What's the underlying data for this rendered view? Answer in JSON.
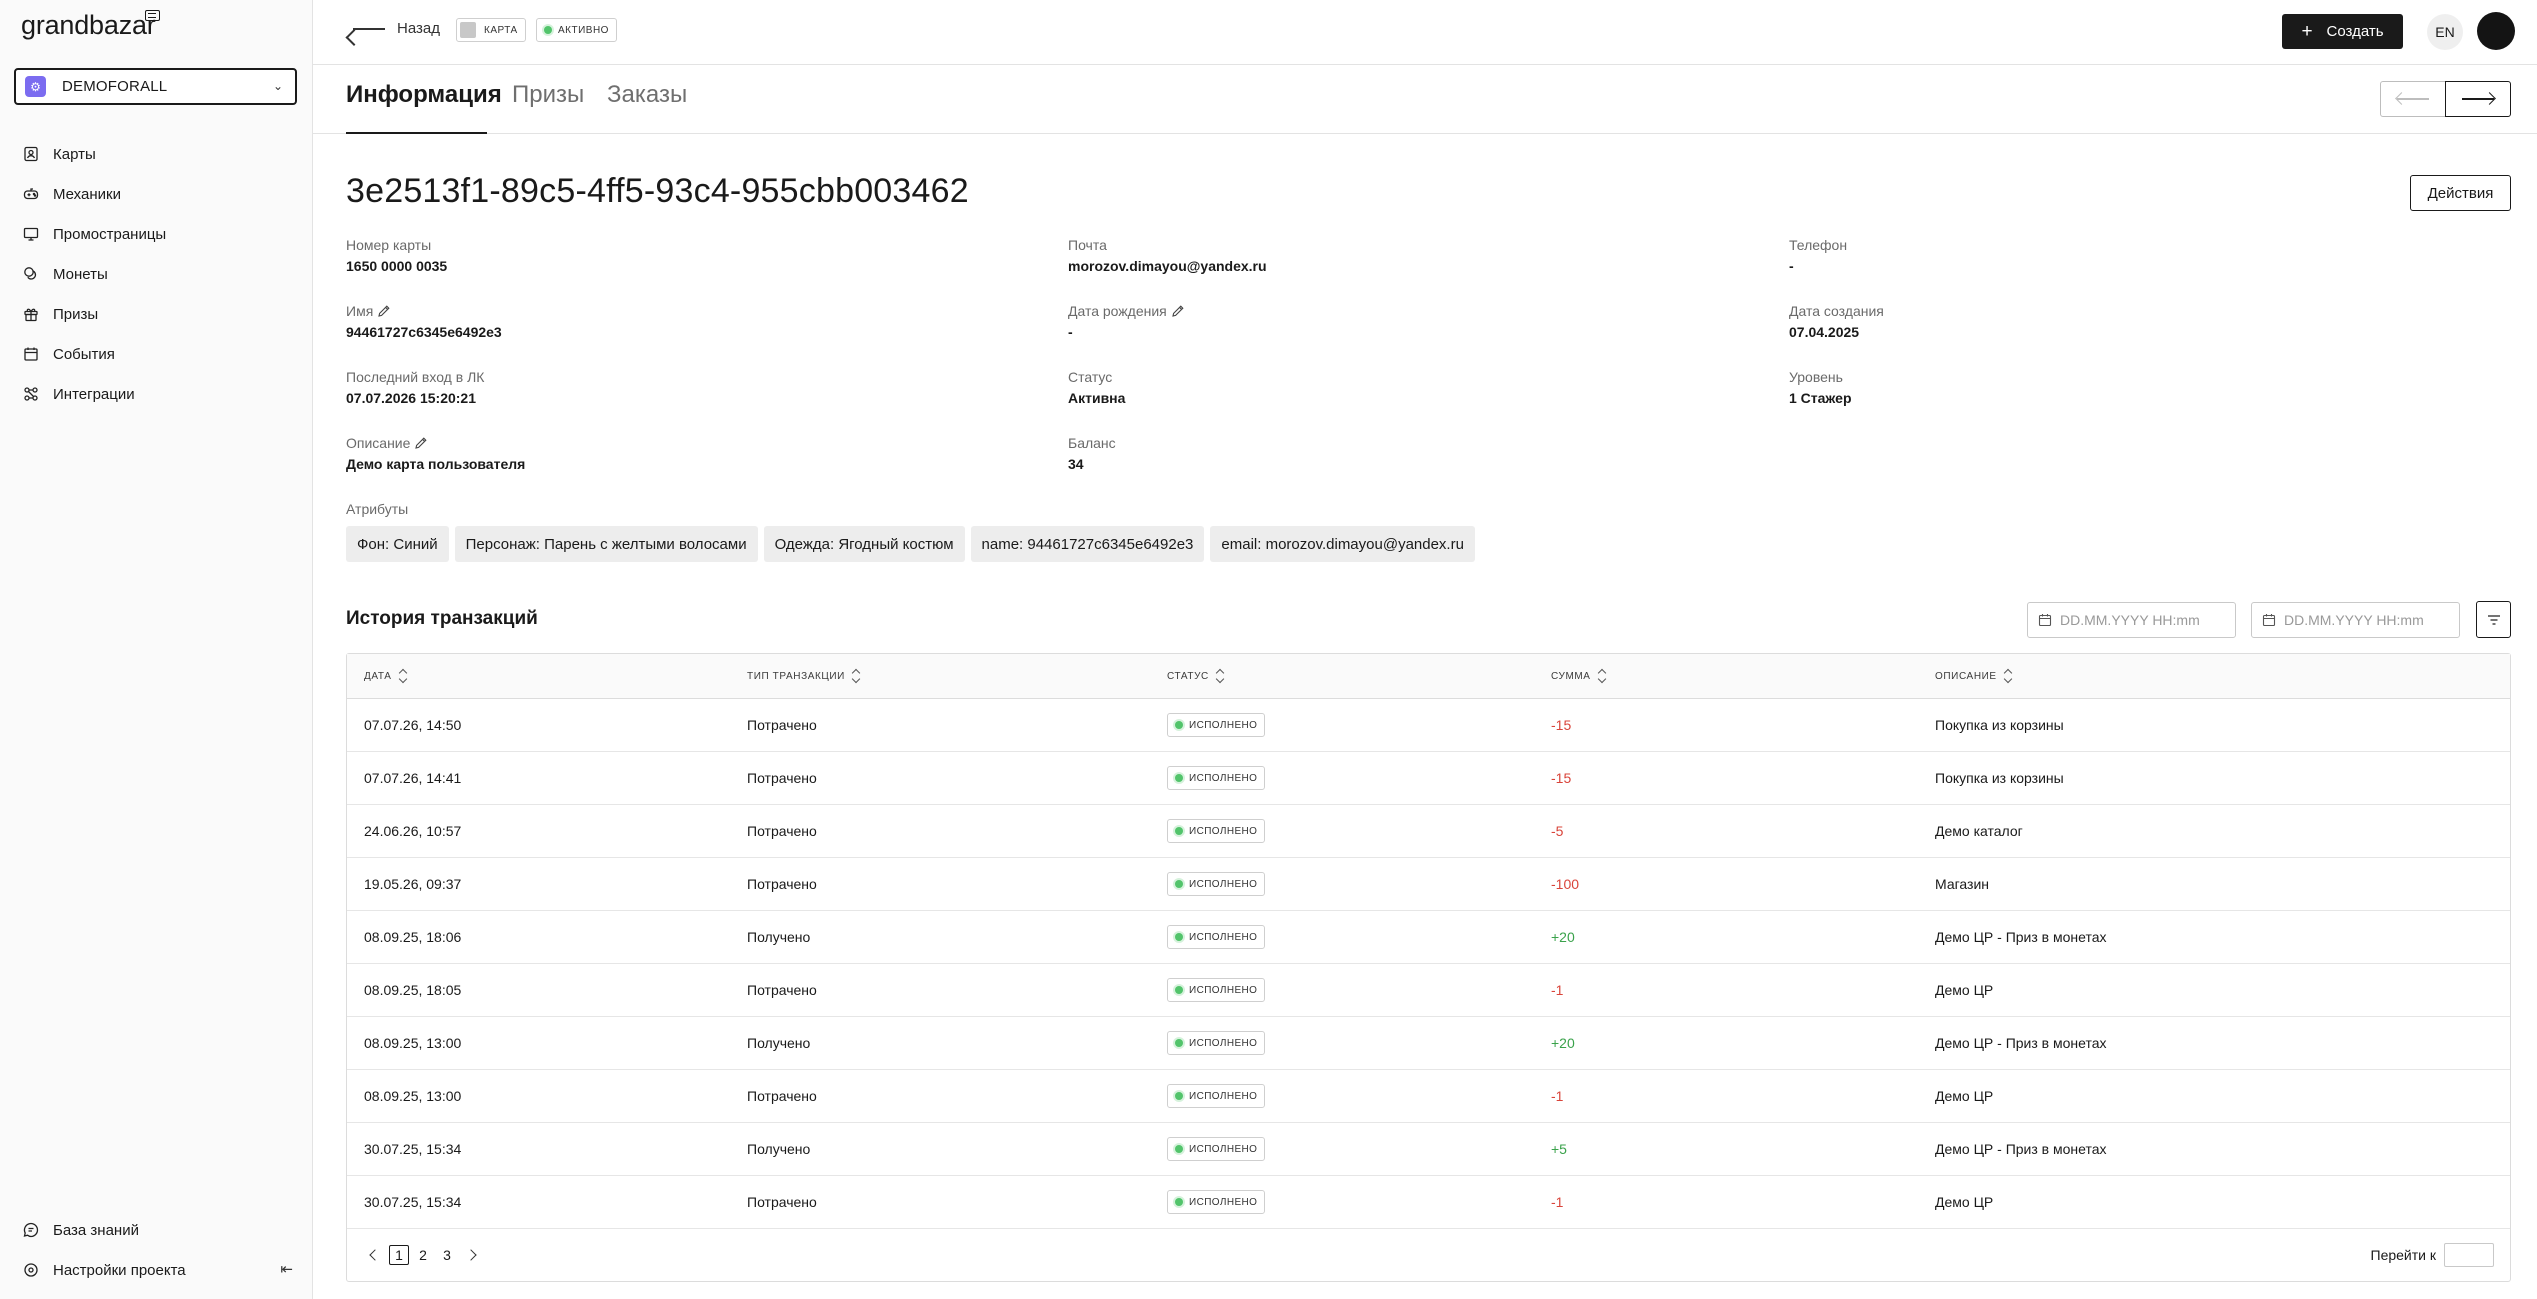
{
  "app": {
    "logo": "grandbazar"
  },
  "sidebar": {
    "project": "DEMOFORALL",
    "items": [
      {
        "label": "Карты",
        "icon": "card-icon"
      },
      {
        "label": "Механики",
        "icon": "gamepad-icon"
      },
      {
        "label": "Промостраницы",
        "icon": "monitor-icon"
      },
      {
        "label": "Монеты",
        "icon": "coins-icon"
      },
      {
        "label": "Призы",
        "icon": "gift-icon"
      },
      {
        "label": "События",
        "icon": "calendar-icon"
      },
      {
        "label": "Интеграции",
        "icon": "integration-icon"
      }
    ],
    "bottom": [
      {
        "label": "База знаний",
        "icon": "knowledge-icon"
      },
      {
        "label": "Настройки проекта",
        "icon": "settings-icon"
      }
    ]
  },
  "header": {
    "back": "Назад",
    "chip_card": "КАРТА",
    "chip_status": "АКТИВНО",
    "create": "Создать",
    "lang": "EN"
  },
  "tabs": [
    "Информация",
    "Призы",
    "Заказы"
  ],
  "card": {
    "id": "3e2513f1-89c5-4ff5-93c4-955cbb003462",
    "actions": "Действия",
    "fields": {
      "number": {
        "label": "Номер карты",
        "value": "1650 0000 0035"
      },
      "email": {
        "label": "Почта",
        "value": "morozov.dimayou@yandex.ru"
      },
      "phone": {
        "label": "Телефон",
        "value": "-"
      },
      "name": {
        "label": "Имя",
        "value": "94461727c6345e6492e3"
      },
      "birthday": {
        "label": "Дата рождения",
        "value": "-"
      },
      "created": {
        "label": "Дата создания",
        "value": "07.04.2025"
      },
      "last_login": {
        "label": "Последний вход в ЛК",
        "value": "07.07.2026 15:20:21"
      },
      "status": {
        "label": "Статус",
        "value": "Активна"
      },
      "level": {
        "label": "Уровень",
        "value": "1 Стажер"
      },
      "description": {
        "label": "Описание",
        "value": "Демо карта пользователя"
      },
      "balance": {
        "label": "Баланс",
        "value": "34"
      }
    },
    "attributes_label": "Атрибуты",
    "attributes": [
      "Фон: Синий",
      "Персонаж: Парень с желтыми волосами",
      "Одежда: Ягодный костюм",
      "name: 94461727c6345e6492e3",
      "email: morozov.dimayou@yandex.ru"
    ]
  },
  "transactions": {
    "title": "История транзакций",
    "date_placeholder": "DD.MM.YYYY HH:mm",
    "columns": [
      "ДАТА",
      "ТИП ТРАНЗАКЦИИ",
      "СТАТУС",
      "СУММА",
      "ОПИСАНИЕ"
    ],
    "rows": [
      {
        "date": "07.07.26, 14:50",
        "type": "Потрачено",
        "status": "ИСПОЛНЕНО",
        "amount": "-15",
        "desc": "Покупка из корзины"
      },
      {
        "date": "07.07.26, 14:41",
        "type": "Потрачено",
        "status": "ИСПОЛНЕНО",
        "amount": "-15",
        "desc": "Покупка из корзины"
      },
      {
        "date": "24.06.26, 10:57",
        "type": "Потрачено",
        "status": "ИСПОЛНЕНО",
        "amount": "-5",
        "desc": "Демо каталог"
      },
      {
        "date": "19.05.26, 09:37",
        "type": "Потрачено",
        "status": "ИСПОЛНЕНО",
        "amount": "-100",
        "desc": "Магазин"
      },
      {
        "date": "08.09.25, 18:06",
        "type": "Получено",
        "status": "ИСПОЛНЕНО",
        "amount": "+20",
        "desc": "Демо ЦР - Приз в монетах"
      },
      {
        "date": "08.09.25, 18:05",
        "type": "Потрачено",
        "status": "ИСПОЛНЕНО",
        "amount": "-1",
        "desc": "Демо ЦР"
      },
      {
        "date": "08.09.25, 13:00",
        "type": "Получено",
        "status": "ИСПОЛНЕНО",
        "amount": "+20",
        "desc": "Демо ЦР - Приз в монетах"
      },
      {
        "date": "08.09.25, 13:00",
        "type": "Потрачено",
        "status": "ИСПОЛНЕНО",
        "amount": "-1",
        "desc": "Демо ЦР"
      },
      {
        "date": "30.07.25, 15:34",
        "type": "Получено",
        "status": "ИСПОЛНЕНО",
        "amount": "+5",
        "desc": "Демо ЦР - Приз в монетах"
      },
      {
        "date": "30.07.25, 15:34",
        "type": "Потрачено",
        "status": "ИСПОЛНЕНО",
        "amount": "-1",
        "desc": "Демо ЦР"
      }
    ],
    "pages": [
      "1",
      "2",
      "3"
    ],
    "current_page": "1",
    "goto_label": "Перейти к"
  },
  "colors": {
    "negative": "#d9443a",
    "positive": "#3aa24b",
    "accent": "#7b6cf0",
    "active_dot": "#52c46b"
  }
}
